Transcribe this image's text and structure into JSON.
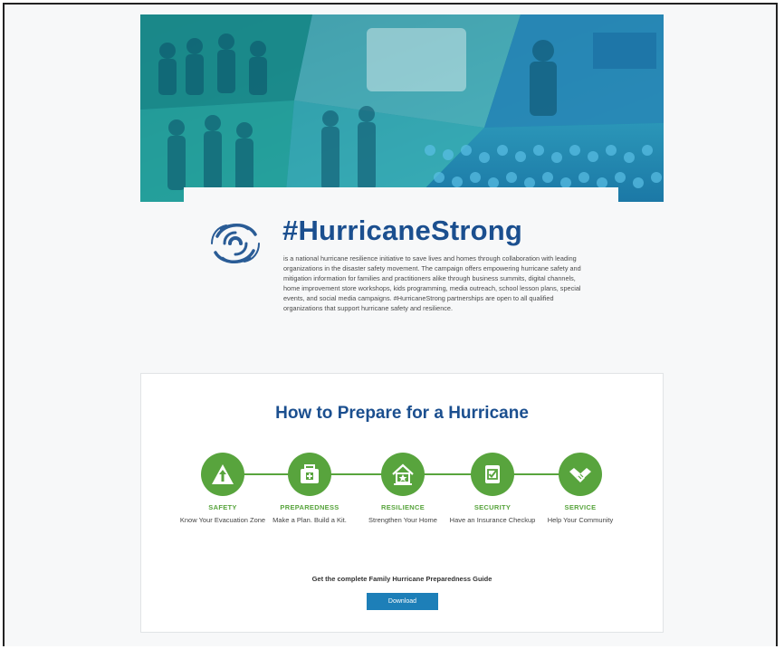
{
  "intro": {
    "title": "#HurricaneStrong",
    "description": "is a national hurricane resilience initiative to save lives and homes through collaboration with leading organizations in the disaster safety movement. The campaign offers empowering hurricane safety and mitigation information for families and practitioners alike through business summits, digital channels, home improvement store workshops, kids programming, media outreach, school lesson plans, special events, and social media campaigns. #HurricaneStrong partnerships are open to all qualified organizations that support hurricane safety and resilience.",
    "logo_icon": "hurricane-swirl-icon"
  },
  "prepare": {
    "title": "How to Prepare for a Hurricane",
    "steps": [
      {
        "name": "SAFETY",
        "desc": "Know Your Evacuation Zone",
        "icon": "evacuation-arrow-icon"
      },
      {
        "name": "PREPAREDNESS",
        "desc": "Make a Plan. Build a Kit.",
        "icon": "kit-icon"
      },
      {
        "name": "RESILIENCE",
        "desc": "Strengthen Your Home",
        "icon": "house-icon"
      },
      {
        "name": "SECURITY",
        "desc": "Have an Insurance Checkup",
        "icon": "document-check-icon"
      },
      {
        "name": "SERVICE",
        "desc": "Help Your Community",
        "icon": "handshake-icon"
      }
    ],
    "guide_text": "Get the complete Family Hurricane Preparedness Guide",
    "download_label": "Download"
  },
  "colors": {
    "brand_blue": "#1b4f8f",
    "step_green": "#58a43d",
    "button_blue": "#1d7fb8",
    "hero_teal": "#1a8aa0"
  }
}
